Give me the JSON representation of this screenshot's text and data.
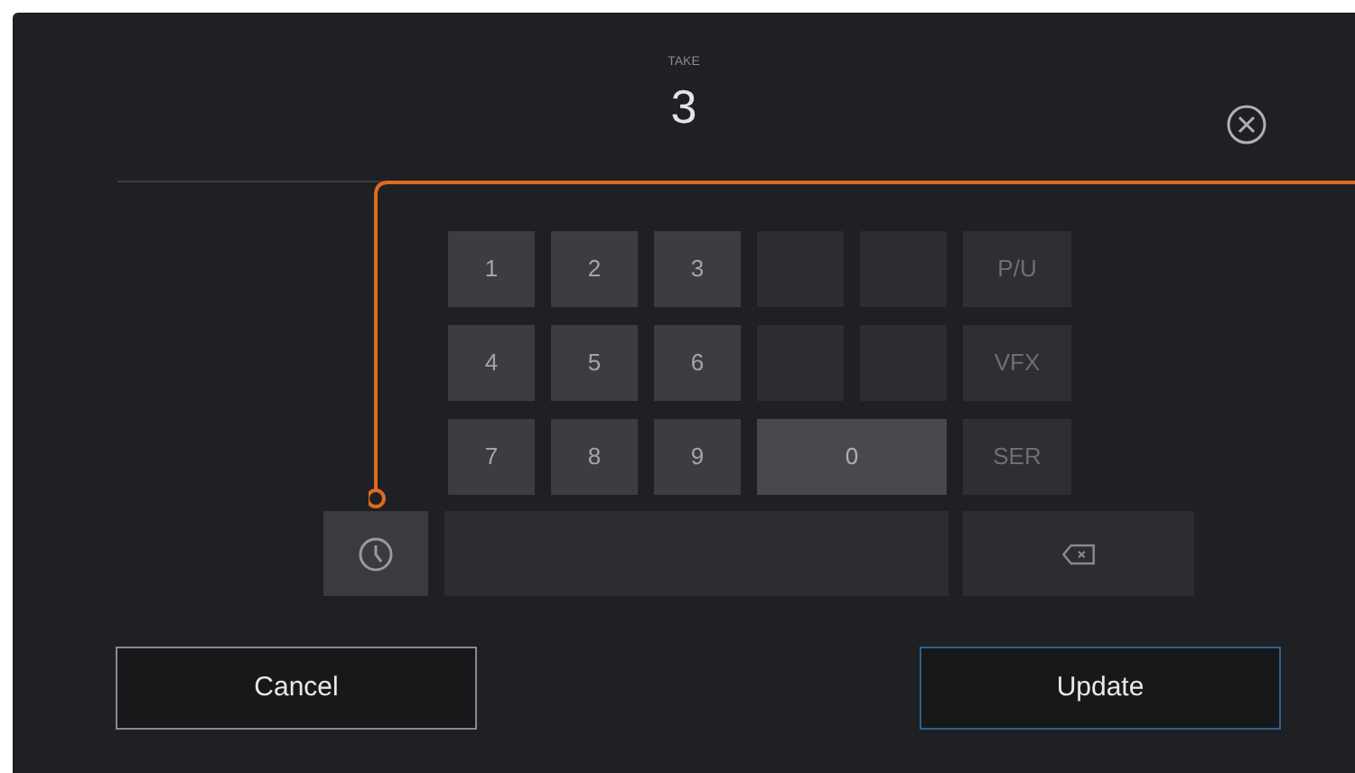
{
  "header": {
    "label": "TAKE",
    "value": "3"
  },
  "keypad": [
    {
      "kind": "key",
      "label": "1"
    },
    {
      "kind": "key",
      "label": "2"
    },
    {
      "kind": "key",
      "label": "3"
    },
    {
      "kind": "blank"
    },
    {
      "kind": "blank"
    },
    {
      "kind": "tag",
      "label": "P/U"
    },
    {
      "kind": "key",
      "label": "4"
    },
    {
      "kind": "key",
      "label": "5"
    },
    {
      "kind": "key",
      "label": "6"
    },
    {
      "kind": "blank"
    },
    {
      "kind": "blank"
    },
    {
      "kind": "tag",
      "label": "VFX"
    },
    {
      "kind": "key",
      "label": "7"
    },
    {
      "kind": "key",
      "label": "8"
    },
    {
      "kind": "key",
      "label": "9"
    },
    {
      "kind": "wide",
      "label": "0"
    },
    {
      "kind": "tag",
      "label": "SER"
    }
  ],
  "buttons": [
    {
      "label": "Cancel",
      "selected": false
    },
    {
      "label": "Update",
      "selected": true
    }
  ]
}
